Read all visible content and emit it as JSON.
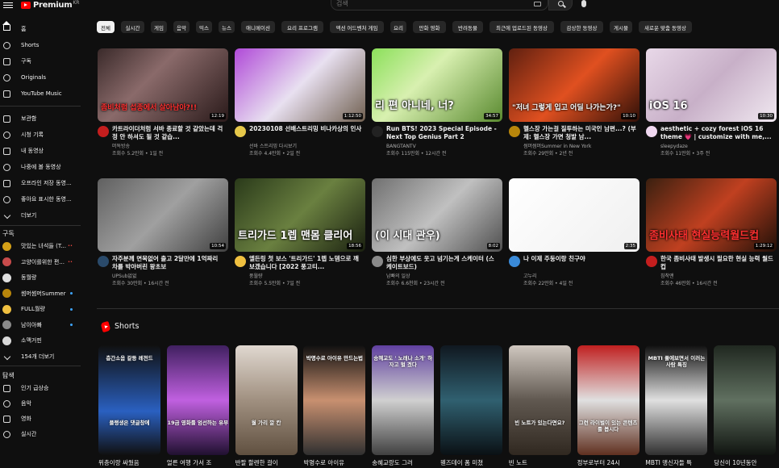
{
  "header": {
    "logo_text": "Premium",
    "logo_region": "KR",
    "search_placeholder": "검색"
  },
  "sidebar": {
    "main": [
      {
        "label": "홈",
        "icon": "home-icon"
      },
      {
        "label": "Shorts",
        "icon": "shorts-icon"
      },
      {
        "label": "구독",
        "icon": "subscriptions-icon"
      },
      {
        "label": "Originals",
        "icon": "originals-icon"
      },
      {
        "label": "YouTube Music",
        "icon": "youtube-music-icon"
      }
    ],
    "library": [
      {
        "label": "보관함",
        "icon": "library-icon"
      },
      {
        "label": "시청 기록",
        "icon": "history-icon"
      },
      {
        "label": "내 동영상",
        "icon": "my-videos-icon"
      },
      {
        "label": "나중에 볼 동영상",
        "icon": "watch-later-icon"
      },
      {
        "label": "오프라인 저장 동영...",
        "icon": "downloads-icon"
      },
      {
        "label": "좋아요 표시한 동영...",
        "icon": "liked-icon"
      },
      {
        "label": "더보기",
        "icon": "chevron-down-icon"
      }
    ],
    "subscriptions_heading": "구독",
    "subscriptions": [
      {
        "label": "맛있는 녀석들 (T...",
        "badge": "live",
        "color": "#d4a017"
      },
      {
        "label": "고양이를위한 편...",
        "badge": "live",
        "color": "#c84b4b"
      },
      {
        "label": "동월량",
        "badge": "",
        "color": "#e0e0e0"
      },
      {
        "label": "썸머썸머Summer i...",
        "badge": "dot",
        "color": "#b8860b"
      },
      {
        "label": "FULL월량",
        "badge": "dot",
        "color": "#f0c040"
      },
      {
        "label": "남이아빠",
        "badge": "dot",
        "color": "#8a8a8a"
      },
      {
        "label": "소맥거핀",
        "badge": "",
        "color": "#d8d8d8"
      },
      {
        "label": "154개 더보기",
        "badge": "",
        "color": ""
      }
    ],
    "live_badge": "••",
    "explore_heading": "탐색",
    "explore": [
      {
        "label": "인기 급상승",
        "icon": "trending-icon"
      },
      {
        "label": "음악",
        "icon": "music-icon"
      },
      {
        "label": "영화",
        "icon": "movies-icon"
      },
      {
        "label": "실시간",
        "icon": "live-icon"
      }
    ]
  },
  "chips": [
    "전체",
    "실시간",
    "게임",
    "음악",
    "믹스",
    "뉴스",
    "애니메이션",
    "요리 프로그램",
    "액션 어드벤처 게임",
    "요리",
    "만화 영화",
    "반려동물",
    "최근에 업로드된 동영상",
    "감상한 동영상",
    "게시물",
    "새로운 맞춤 동영상"
  ],
  "videos": [
    {
      "title": "카트라이더처럼 서바 종료할 것 같았는데 걱정 안 하셔도 될 것 같습...",
      "channel": "머독방송",
      "meta": "조회수 5.2만회 • 1일 전",
      "duration": "12:19",
      "thumb_text": "좀비처럼 섭종에서 살아남아?!!",
      "thumb_bg": "linear-gradient(135deg,#3a2a2a,#8a6a6a 40%,#2a1a1a)",
      "avatar": "#c41e1e"
    },
    {
      "title": "20230108 선배스트리밍 비나카상의 인사",
      "channel": "선바 스트리밍 다시보기",
      "meta": "조회수 4.4만회 • 2일 전",
      "duration": "1:12:50",
      "thumb_text": "",
      "thumb_bg": "linear-gradient(135deg,#b04ad8,#e8e0f0 50%,#706050)",
      "avatar": "#e6c84a"
    },
    {
      "title": "Run BTS! 2023 Special Episode - Next Top Genius Part 2",
      "channel": "BANGTANTV",
      "meta": "조회수 115만회 • 12시간 전",
      "duration": "34:57",
      "thumb_text": "리 편 아니네, 너?",
      "thumb_bg": "linear-gradient(135deg,#8be05a,#d8f0b0 40%,#5a8a30)",
      "avatar": "#222222"
    },
    {
      "title": "헬스장 가는걸 질투하는 미국인 남편...? (부제: 헬스장 가면 청발 남...",
      "channel": "썸머썸머Summer in New York",
      "meta": "조회수 29만회 • 2년 전",
      "duration": "10:10",
      "thumb_text": "\"저녀 그렇게 입고 어딜 나가는가?\"",
      "thumb_bg": "linear-gradient(135deg,#602010,#e05020 50%,#301008)",
      "avatar": "#b8860b"
    },
    {
      "title": "aesthetic + cozy forest iOS 16 theme 💗 | customize with me,...",
      "channel": "sleepydaze",
      "meta": "조회수 11만회 • 3주 전",
      "duration": "10:30",
      "thumb_text": "iOS 16",
      "thumb_bg": "linear-gradient(135deg,#e8d8e8,#c8b0c8 50%,#f0e8f0)",
      "avatar": "#f0d8f0"
    },
    {
      "title": "자주분께 면목없어 출고 2달만에 1억짜리 차를 박아버린 왕초보",
      "channel": "UPSub없없",
      "meta": "조회수 30만회 • 16시간 전",
      "duration": "10:54",
      "thumb_text": "",
      "thumb_bg": "linear-gradient(135deg,#606060,#a0a0a0 50%,#404040)",
      "avatar": "#2a4a6a"
    },
    {
      "title": "엘든링 첫 보스 '트리가드' 1렙 노뎀으로 깨보겠습니다 [2022 풍고티...",
      "channel": "풍월량",
      "meta": "조회수 5.5만회 • 7일 전",
      "duration": "18:56",
      "thumb_text": "트리가드 1렙 맨몸 클리어",
      "thumb_bg": "linear-gradient(135deg,#2a3a1a,#6a8040 50%,#1a2010)",
      "avatar": "#f0c040"
    },
    {
      "title": "심한 부상에도 웃고 넘기는게 스케이터 (스케이트보드)",
      "channel": "남빠의 일상",
      "meta": "조회수 6.6천회 • 23시간 전",
      "duration": "8:02",
      "thumb_text": "(이 시대 관우)",
      "thumb_bg": "linear-gradient(135deg,#707070,#c0c0c0 50%,#505050)",
      "avatar": "#8a8a8a"
    },
    {
      "title": "나 이제 주둥이랑 친구야",
      "channel": "고누리",
      "meta": "조회수 22만회 • 4일 전",
      "duration": "2:35",
      "thumb_text": "",
      "thumb_bg": "linear-gradient(135deg,#ffffff,#f0f0f0)",
      "avatar": "#3a8ad8"
    },
    {
      "title": "한국 좀비사태 발생시 필요한 현실 능력 월드컵",
      "channel": "침착맨",
      "meta": "조회수 46만회 • 16시간 전",
      "duration": "1:29:12",
      "thumb_text": "좀비사태 현실능력월드컵",
      "thumb_bg": "linear-gradient(135deg,#3a2010,#c04020 50%,#201008)",
      "avatar": "#c41e1e"
    }
  ],
  "shorts_heading": "Shorts",
  "shorts": [
    {
      "title": "위층이랑 싸웠음",
      "cap_top": "층간소음 갈등 레전드",
      "cap_bottom": "플랭생은 댓글창에",
      "bg": "linear-gradient(180deg,#101010,#2a60c0 60%,#101010)"
    },
    {
      "title": "얼른 여행 가서 조",
      "cap_top": "",
      "cap_bottom": "19금 영화를 엄선하는 유부",
      "bg": "linear-gradient(180deg,#402060,#c060e0 50%,#201030)"
    },
    {
      "title": "반팔 할렌한 걸이",
      "cap_top": "",
      "cap_bottom": "월 가리 깔 칸",
      "bg": "linear-gradient(180deg,#e0d8d0,#a09080 50%,#605040)"
    },
    {
      "title": "박명수로 아이유",
      "cap_top": "박명수로 아이유 만드는법",
      "cap_bottom": "",
      "bg": "linear-gradient(180deg,#101010,#c89070 50%,#303030)"
    },
    {
      "title": "송혜교랑도 그러",
      "cap_top": "송혜교도 ' 노래나 소개' 하자고 헐 겠다",
      "cap_bottom": "",
      "bg": "linear-gradient(180deg,#6040a0,#d0d0d0 50%,#404040)"
    },
    {
      "title": "웬즈데이 폼 미쳤",
      "cap_top": "",
      "cap_bottom": "",
      "bg": "linear-gradient(180deg,#101820,#306070 50%,#0a1014)"
    },
    {
      "title": "빈 노트",
      "cap_top": "",
      "cap_bottom": "빈 노트가 있는다면요?",
      "bg": "linear-gradient(180deg,#d0c8c0,#605850 50%,#302820)"
    },
    {
      "title": "정부로부터 24시",
      "cap_top": "",
      "cap_bottom": "그런 라이벌이 있는 콘텐츠를 봅시다",
      "bg": "linear-gradient(180deg,#c02020,#e0e0e0 50%,#603020)"
    },
    {
      "title": "MBTI 맹신자들 특",
      "cap_top": "MBTI 풀에보면서 이러는 사람 특징",
      "cap_bottom": "",
      "bg": "linear-gradient(180deg,#101010,#e0e0e0 50%,#303030)"
    },
    {
      "title": "당신이 10년동안",
      "cap_top": "",
      "cap_bottom": "",
      "bg": "linear-gradient(180deg,#202820,#607060 50%,#101410)"
    }
  ],
  "colors": {
    "accent": "#ff0000",
    "link": "#3ea6ff",
    "bg": "#0f0f0f",
    "chip": "#272727"
  }
}
